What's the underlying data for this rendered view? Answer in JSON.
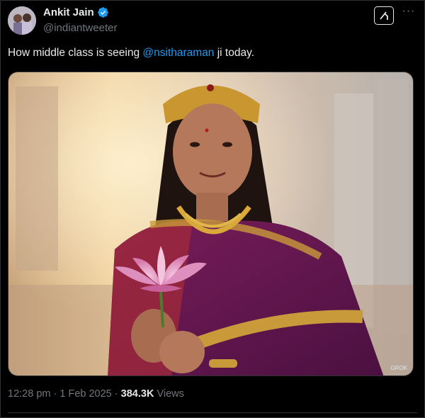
{
  "author": {
    "name": "Ankit Jain",
    "handle": "@indiantweeter",
    "verified": true
  },
  "header": {
    "grok_icon": "grok-icon",
    "more_icon": "more-icon",
    "more_label": "···"
  },
  "post": {
    "text_before": "How middle class is seeing ",
    "mention": "@nsitharaman",
    "text_after": " ji today.",
    "media_watermark": "GROK"
  },
  "meta": {
    "time": "12:28 pm",
    "date": "1 Feb 2025",
    "separator": "·",
    "views_count": "384.3K",
    "views_label": "Views"
  },
  "colors": {
    "background": "#000000",
    "text": "#e7e9ea",
    "secondary": "#71767b",
    "link": "#1d9bf0",
    "verified": "#1d9bf0"
  }
}
